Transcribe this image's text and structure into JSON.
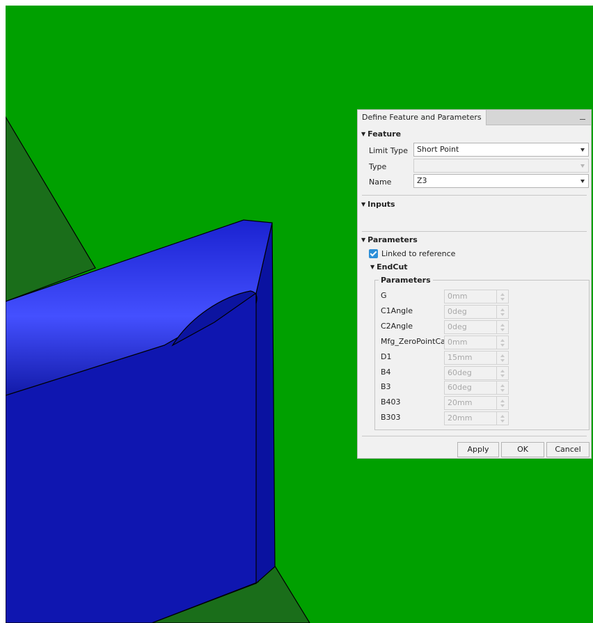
{
  "viewport": {
    "background_color": "#00a000",
    "plane_color": "#1a6e1a",
    "plate_color": "#0f16b8",
    "plate_top_color": "#1e26e0"
  },
  "dialog": {
    "title": "Define Feature and Parameters",
    "sections": {
      "feature": "Feature",
      "inputs": "Inputs",
      "parameters": "Parameters"
    },
    "feature": {
      "limit_type_label": "Limit Type",
      "limit_type_value": "Short Point",
      "type_label": "Type",
      "type_value": "",
      "name_label": "Name",
      "name_value": "Z3"
    },
    "linked_label": "Linked to reference",
    "linked_checked": true,
    "endcut_label": "EndCut",
    "group_title": "Parameters",
    "params": [
      {
        "name": "G",
        "value": "0mm"
      },
      {
        "name": "C1Angle",
        "value": "0deg"
      },
      {
        "name": "C2Angle",
        "value": "0deg"
      },
      {
        "name": "Mfg_ZeroPointCalc",
        "value": "0mm"
      },
      {
        "name": "D1",
        "value": "15mm"
      },
      {
        "name": "B4",
        "value": "60deg"
      },
      {
        "name": "B3",
        "value": "60deg"
      },
      {
        "name": "B403",
        "value": "20mm"
      },
      {
        "name": "B303",
        "value": "20mm"
      }
    ],
    "buttons": {
      "apply": "Apply",
      "ok": "OK",
      "cancel": "Cancel"
    },
    "accent_color": "#2d8fd8"
  }
}
